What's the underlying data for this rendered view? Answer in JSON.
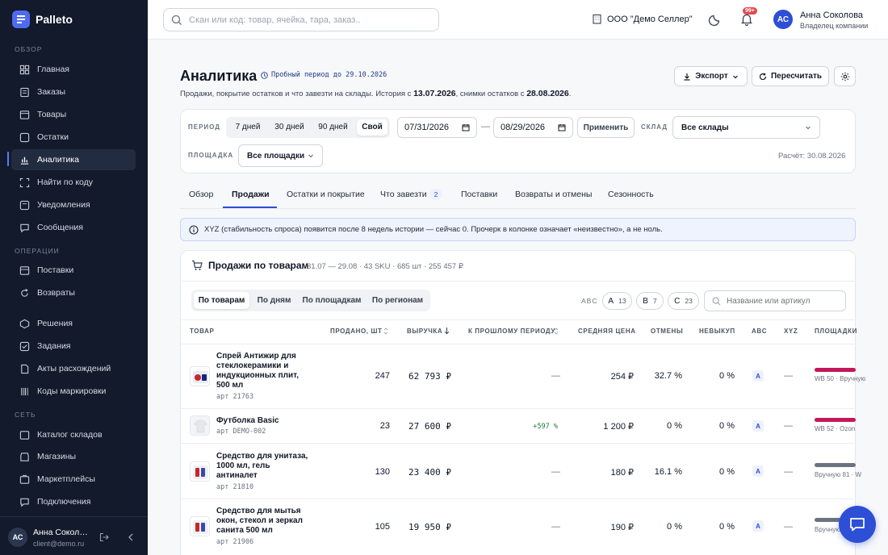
{
  "app": {
    "name": "Palleto"
  },
  "sidebar": {
    "sections": [
      "ОБЗОР",
      "ОПЕРАЦИИ",
      "СЕТЬ"
    ],
    "items": [
      {
        "label": "Главная",
        "icon": "home-icon"
      },
      {
        "label": "Заказы",
        "icon": "orders-icon"
      },
      {
        "label": "Товары",
        "icon": "box-icon"
      },
      {
        "label": "Остатки",
        "icon": "stock-icon"
      },
      {
        "label": "Аналитика",
        "icon": "chart-icon",
        "active": true
      },
      {
        "label": "Найти по коду",
        "icon": "scan-icon"
      },
      {
        "label": "Уведомления",
        "icon": "bell-icon"
      },
      {
        "label": "Сообщения",
        "icon": "message-icon"
      },
      {
        "label": "Поставки",
        "icon": "truck-icon"
      },
      {
        "label": "Возвраты",
        "icon": "return-icon"
      },
      {
        "label": "Решения",
        "icon": "decision-icon"
      },
      {
        "label": "Задания",
        "icon": "task-icon"
      },
      {
        "label": "Акты расхождений",
        "icon": "doc-icon"
      },
      {
        "label": "Коды маркировки",
        "icon": "barcode-icon"
      },
      {
        "label": "Каталог складов",
        "icon": "warehouse-icon"
      },
      {
        "label": "Магазины",
        "icon": "store-icon"
      },
      {
        "label": "Маркетплейсы",
        "icon": "market-icon"
      },
      {
        "label": "Подключения",
        "icon": "link-icon"
      }
    ],
    "user": {
      "initials": "АС",
      "name": "Анна Соколова",
      "email": "client@demo.ru"
    }
  },
  "topbar": {
    "search_placeholder": "Скан или код: товар, ячейка, тара, заказ..",
    "org": "ООО \"Демо Селлер\"",
    "notif_badge": "99+",
    "user": {
      "initials": "АС",
      "name": "Анна Соколова",
      "role": "Владелец компании"
    }
  },
  "page": {
    "title": "Аналитика",
    "trial": "Пробный период до 29.10.2026",
    "subtitle_a": "Продажи, покрытие остатков и что завезти на склады. История с ",
    "history_date": "13.07.2026",
    "subtitle_b": ", снимки остатков с ",
    "snapshot_date": "28.08.2026",
    "subtitle_c": ".",
    "export_label": "Экспорт",
    "recalc_label": "Пересчитать"
  },
  "filters": {
    "period_label": "ПЕРИОД",
    "period_options": [
      "7 дней",
      "30 дней",
      "90 дней",
      "Свой"
    ],
    "period_selected": "Свой",
    "date_from": "07/31/2026",
    "date_to": "08/29/2026",
    "date_sep": "—",
    "apply_label": "Применить",
    "warehouse_label": "СКЛАД",
    "warehouse_value": "Все склады",
    "platform_label": "ПЛОЩАДКА",
    "platform_value": "Все площадки",
    "calc_date": "Расчёт: 30.08.2026"
  },
  "tabs": [
    {
      "label": "Обзор"
    },
    {
      "label": "Продажи",
      "active": true
    },
    {
      "label": "Остатки и покрытие"
    },
    {
      "label": "Что завезти",
      "badge": "2"
    },
    {
      "label": "Поставки"
    },
    {
      "label": "Возвраты и отмены"
    },
    {
      "label": "Сезонность"
    }
  ],
  "info": "XYZ (стабильность спроса) появится после 8 недель истории — сейчас 0. Прочерк в колонке означает «неизвестно», а не ноль.",
  "sales": {
    "title": "Продажи по товарам",
    "meta": "31.07 — 29.08 · 43 SKU · 685 шт · 255 457 ₽",
    "views": [
      "По товарам",
      "По дням",
      "По площадкам",
      "По регионам"
    ],
    "abc_label": "ABC",
    "abc_pills": [
      {
        "letter": "A",
        "count": "13"
      },
      {
        "letter": "B",
        "count": "7"
      },
      {
        "letter": "C",
        "count": "23"
      }
    ],
    "search_placeholder": "Название или артикул",
    "columns": [
      "ТОВАР",
      "ПРОДАНО, ШТ",
      "ВЫРУЧКА",
      "К ПРОШЛОМУ ПЕРИОДУ",
      "СРЕДНЯЯ ЦЕНА",
      "ОТМЕНЫ",
      "НЕВЫКУП",
      "ABC",
      "XYZ",
      "ПЛОЩАДКИ"
    ],
    "rows": [
      {
        "name": "Спрей Антижир для стеклокерамики и индукционных плит, 500 мл",
        "art": "арт 21763",
        "sold": "247",
        "revenue": "62 793 ₽",
        "delta": "—",
        "avg": "254 ₽",
        "cancel": "32.7 %",
        "nobuy": "0 %",
        "abc": "A",
        "xyz": "—",
        "platforms": "WB 50 · Вручную",
        "bar_color": "#c2185b"
      },
      {
        "name": "Футболка Basic",
        "art": "арт DEMO-002",
        "sold": "23",
        "revenue": "27 600 ₽",
        "delta": "+597 %",
        "avg": "1 200 ₽",
        "cancel": "0 %",
        "nobuy": "0 %",
        "abc": "A",
        "xyz": "—",
        "platforms": "WB 52 · Ozon",
        "bar_color": "#c2185b"
      },
      {
        "name": "Средство для унитаза, 1000 мл, гель антиналет",
        "art": "арт 21810",
        "sold": "130",
        "revenue": "23 400 ₽",
        "delta": "—",
        "avg": "180 ₽",
        "cancel": "16.1 %",
        "nobuy": "0 %",
        "abc": "A",
        "xyz": "—",
        "platforms": "Вручную 81 · W",
        "bar_color": "#6b7280"
      },
      {
        "name": "Средство для мытья окон, стекол и зеркал санита 500 мл",
        "art": "арт 21906",
        "sold": "105",
        "revenue": "19 950 ₽",
        "delta": "—",
        "avg": "190 ₽",
        "cancel": "0 %",
        "nobuy": "0 %",
        "abc": "A",
        "xyz": "—",
        "platforms": "Вручную",
        "bar_color": "#6b7280"
      }
    ]
  }
}
